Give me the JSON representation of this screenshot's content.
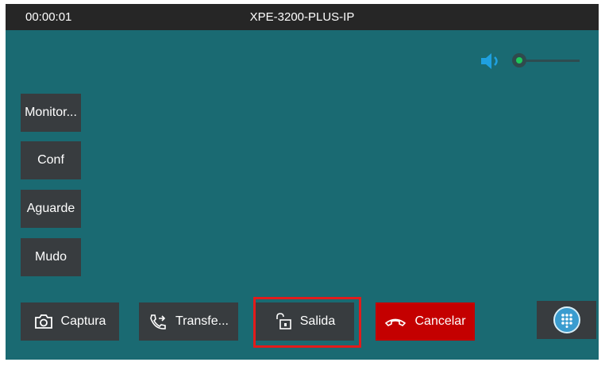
{
  "status_bar": {
    "timer": "00:00:01",
    "device_name": "XPE-3200-PLUS-IP"
  },
  "volume": {
    "icon": "speaker-icon",
    "level": 0.0
  },
  "side_buttons": [
    {
      "label": "Monitor..."
    },
    {
      "label": "Conf"
    },
    {
      "label": "Aguarde"
    },
    {
      "label": "Mudo"
    }
  ],
  "bottom_buttons": {
    "capture": {
      "label": "Captura",
      "icon": "camera-icon"
    },
    "transfer": {
      "label": "Transfe...",
      "icon": "phone-transfer-icon"
    },
    "exit": {
      "label": "Salida",
      "icon": "unlock-icon"
    },
    "cancel": {
      "label": "Cancelar",
      "icon": "hang-up-icon",
      "color": "#c40000"
    }
  },
  "keypad": {
    "icon": "dialpad-icon",
    "color": "#3a9ccf"
  },
  "colors": {
    "background": "#1a6a72",
    "top_bar": "#262626",
    "button": "#383c3f",
    "highlight": "#e21b1b",
    "slider_knob": "#1ec85a"
  }
}
